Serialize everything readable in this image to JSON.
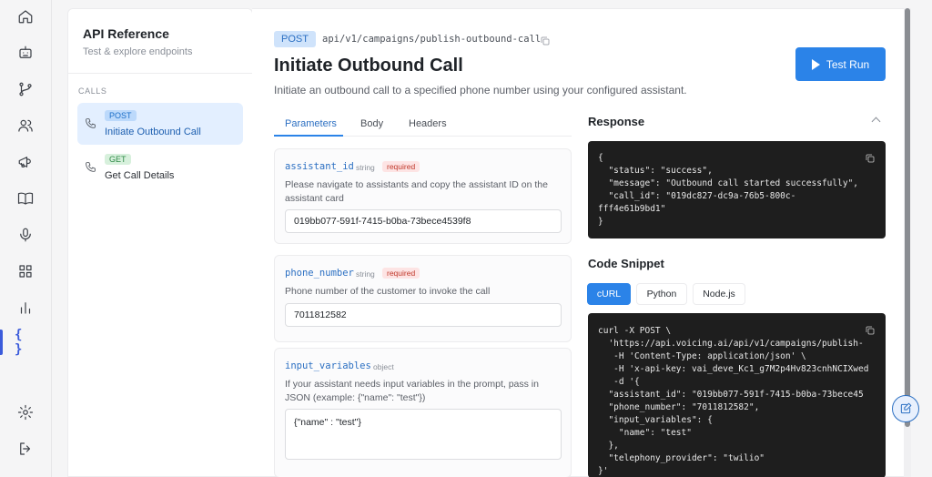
{
  "sidebar": {
    "title": "API Reference",
    "subtitle": "Test & explore endpoints",
    "section": "CALLS",
    "endpoints": [
      {
        "method": "POST",
        "label": "Initiate Outbound Call"
      },
      {
        "method": "GET",
        "label": "Get Call Details"
      }
    ]
  },
  "rail": {
    "icons": [
      "home-icon",
      "bot-icon",
      "branch-icon",
      "users-icon",
      "megaphone-icon",
      "book-icon",
      "mic-icon",
      "grid-icon",
      "bar-chart-icon",
      "code-braces-icon",
      "settings-icon",
      "logout-icon"
    ],
    "active_label": "{ }"
  },
  "endpoint": {
    "method": "POST",
    "path": "api/v1/campaigns/publish-outbound-call",
    "title": "Initiate Outbound Call",
    "description": "Initiate an outbound call to a specified phone number using your configured assistant.",
    "test_run_label": "Test Run"
  },
  "tabs": [
    "Parameters",
    "Body",
    "Headers"
  ],
  "params": [
    {
      "name": "assistant_id",
      "type": "string",
      "required": "required",
      "description": "Please navigate to assistants and copy the assistant ID on the assistant card",
      "value": "019bb077-591f-7415-b0ba-73bece4539f8"
    },
    {
      "name": "phone_number",
      "type": "string",
      "required": "required",
      "description": "Phone number of the customer to invoke the call",
      "value": "7011812582"
    },
    {
      "name": "input_variables",
      "type": "object",
      "description": "If your assistant needs input variables in the prompt, pass in JSON (example: {\"name\": \"test\"})",
      "value": "{\"name\" : \"test\"}"
    }
  ],
  "response": {
    "title": "Response",
    "body": "{\n  \"status\": \"success\",\n  \"message\": \"Outbound call started successfully\",\n  \"call_id\": \"019dc827-dc9a-76b5-800c-\nfff4e61b9bd1\"\n}"
  },
  "snippet": {
    "title": "Code Snippet",
    "languages": [
      "cURL",
      "Python",
      "Node.js"
    ],
    "active_language": "cURL",
    "code": "curl -X POST \\\n  'https://api.voicing.ai/api/v1/campaigns/publish-\n   -H 'Content-Type: application/json' \\\n   -H 'x-api-key: vai_deve_Kc1_g7M2p4Hv823cnhNCIXwed\n   -d '{\n  \"assistant_id\": \"019bb077-591f-7415-b0ba-73bece45\n  \"phone_number\": \"7011812582\",\n  \"input_variables\": {\n    \"name\": \"test\"\n  },\n  \"telephony_provider\": \"twilio\"\n}'"
  }
}
